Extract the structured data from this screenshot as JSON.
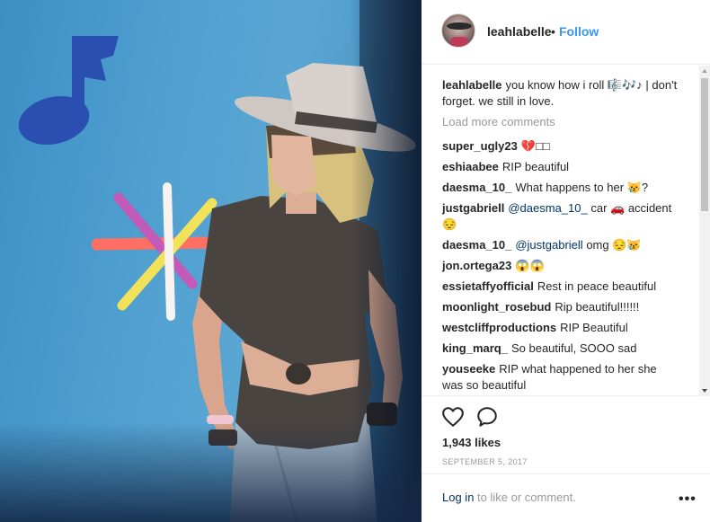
{
  "post": {
    "username": "leahlabelle",
    "separator": "•",
    "follow_label": "Follow"
  },
  "caption": {
    "username": "leahlabelle",
    "text": "you know how i roll 🎼🎶♪ | don't forget. we still in love."
  },
  "load_more_label": "Load more comments",
  "comments": [
    {
      "username": "super_ugly23",
      "text": "💔□□"
    },
    {
      "username": "eshiaabee",
      "text": "RIP beautiful"
    },
    {
      "username": "daesma_10_",
      "text": "What happens to her 😿?"
    },
    {
      "username": "justgabriell",
      "mention": "@daesma_10_",
      "text": "car 🚗 accident 😔"
    },
    {
      "username": "daesma_10_",
      "mention": "@justgabriell",
      "text": "omg 😔😿"
    },
    {
      "username": "jon.ortega23",
      "text": "😱😱"
    },
    {
      "username": "essietaffyofficial",
      "text": "Rest in peace beautiful"
    },
    {
      "username": "moonlight_rosebud",
      "text": "Rip beautiful!!!!!!"
    },
    {
      "username": "westcliffproductions",
      "text": "RIP Beautiful"
    },
    {
      "username": "king_marq_",
      "text": "So beautiful, SOOO sad"
    },
    {
      "username": "youseeke",
      "text": "RIP what happened to her she was so beautiful"
    }
  ],
  "likes_label": "1,943 likes",
  "date_label": "SEPTEMBER 5, 2017",
  "footer": {
    "login_label": "Log in",
    "login_suffix": " to like or comment.",
    "more_label": "•••"
  },
  "icons": {
    "like": "heart-outline-icon",
    "comment": "speech-bubble-icon",
    "more": "ellipsis-icon"
  },
  "colors": {
    "accent": "#3897f0",
    "link": "#003569",
    "muted": "#999999",
    "text": "#262626"
  }
}
